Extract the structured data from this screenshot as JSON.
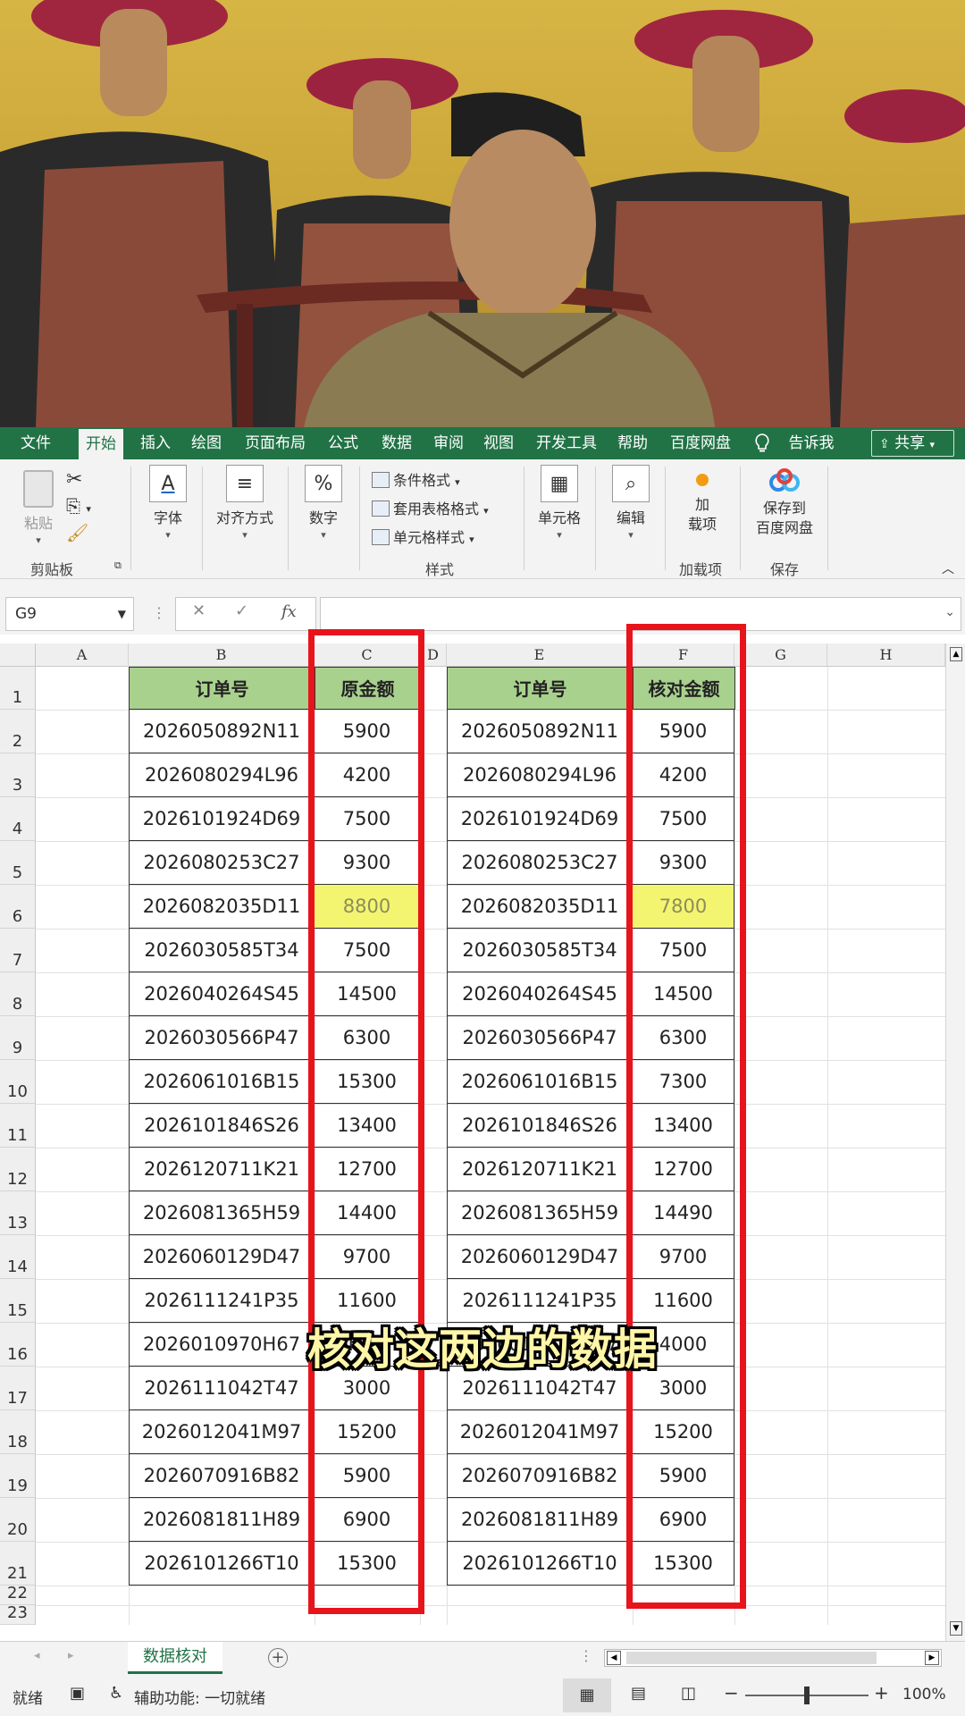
{
  "ribbon_tabs": [
    "文件",
    "开始",
    "插入",
    "绘图",
    "页面布局",
    "公式",
    "数据",
    "审阅",
    "视图",
    "开发工具",
    "帮助",
    "百度网盘",
    "告诉我"
  ],
  "active_tab": "开始",
  "share_label": "共享",
  "clipboard": {
    "paste": "粘贴",
    "group": "剪贴板"
  },
  "font": {
    "label": "字体"
  },
  "align": {
    "label": "对齐方式"
  },
  "number": {
    "label": "数字",
    "icon": "%"
  },
  "styles": {
    "conditional": "条件格式",
    "table": "套用表格格式",
    "cell": "单元格样式",
    "group": "样式"
  },
  "cells": {
    "label": "单元格"
  },
  "editing": {
    "label": "编辑"
  },
  "addins": {
    "label_line1": "加",
    "label_line2": "载项",
    "group": "加载项"
  },
  "save": {
    "label_line1": "保存到",
    "label_line2": "百度网盘",
    "group": "保存"
  },
  "namebox": "G9",
  "fx": "fx",
  "columns": [
    "A",
    "B",
    "C",
    "D",
    "E",
    "F",
    "G",
    "H"
  ],
  "rows": [
    "1",
    "2",
    "3",
    "4",
    "5",
    "6",
    "7",
    "8",
    "9",
    "10",
    "11",
    "12",
    "13",
    "14",
    "15",
    "16",
    "17",
    "18",
    "19",
    "20",
    "21",
    "22",
    "23"
  ],
  "table_left": {
    "headers": [
      "订单号",
      "原金额"
    ],
    "rows": [
      [
        "2026050892N11",
        "5900"
      ],
      [
        "2026080294L96",
        "4200"
      ],
      [
        "2026101924D69",
        "7500"
      ],
      [
        "2026080253C27",
        "9300"
      ],
      [
        "2026082035D11",
        "8800"
      ],
      [
        "2026030585T34",
        "7500"
      ],
      [
        "2026040264S45",
        "14500"
      ],
      [
        "2026030566P47",
        "6300"
      ],
      [
        "2026061016B15",
        "15300"
      ],
      [
        "2026101846S26",
        "13400"
      ],
      [
        "2026120711K21",
        "12700"
      ],
      [
        "2026081365H59",
        "14400"
      ],
      [
        "2026060129D47",
        "9700"
      ],
      [
        "2026111241P35",
        "11600"
      ],
      [
        "2026010970H67",
        "4000"
      ],
      [
        "2026111042T47",
        "3000"
      ],
      [
        "2026012041M97",
        "15200"
      ],
      [
        "2026070916B82",
        "5900"
      ],
      [
        "2026081811H89",
        "6900"
      ],
      [
        "2026101266T10",
        "15300"
      ]
    ]
  },
  "table_right": {
    "headers": [
      "订单号",
      "核对金额"
    ],
    "rows": [
      [
        "2026050892N11",
        "5900"
      ],
      [
        "2026080294L96",
        "4200"
      ],
      [
        "2026101924D69",
        "7500"
      ],
      [
        "2026080253C27",
        "9300"
      ],
      [
        "2026082035D11",
        "7800"
      ],
      [
        "2026030585T34",
        "7500"
      ],
      [
        "2026040264S45",
        "14500"
      ],
      [
        "2026030566P47",
        "6300"
      ],
      [
        "2026061016B15",
        "7300"
      ],
      [
        "2026101846S26",
        "13400"
      ],
      [
        "2026120711K21",
        "12700"
      ],
      [
        "2026081365H59",
        "14490"
      ],
      [
        "2026060129D47",
        "9700"
      ],
      [
        "2026111241P35",
        "11600"
      ],
      [
        "2026010970H67",
        "4000"
      ],
      [
        "2026111042T47",
        "3000"
      ],
      [
        "2026012041M97",
        "15200"
      ],
      [
        "2026070916B82",
        "5900"
      ],
      [
        "2026081811H89",
        "6900"
      ],
      [
        "2026101266T10",
        "15300"
      ]
    ]
  },
  "highlighted_row_index": 4,
  "subtitle": "核对这两边的数据",
  "sheet_tab": "数据核对",
  "status": {
    "ready": "就绪",
    "accessibility": "辅助功能: 一切就绪",
    "zoom": "100%"
  },
  "colors": {
    "excel_green": "#217346",
    "header_fill": "#a9d18e",
    "highlight": "#f3f570",
    "red_box": "#e8141c"
  }
}
